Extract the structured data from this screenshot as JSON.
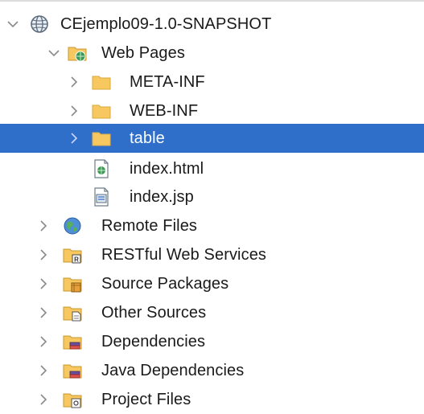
{
  "project_tree": {
    "root": {
      "label": "CEjemplo09-1.0-SNAPSHOT",
      "icon": "globe-project-icon",
      "expanded": true
    },
    "web_pages": {
      "label": "Web Pages",
      "icon": "web-pages-folder-icon",
      "expanded": true
    },
    "meta_inf": {
      "label": "META-INF",
      "icon": "folder-icon"
    },
    "web_inf": {
      "label": "WEB-INF",
      "icon": "folder-icon"
    },
    "table": {
      "label": "table",
      "icon": "folder-icon",
      "selected": true
    },
    "index_html": {
      "label": "index.html",
      "icon": "html-file-icon"
    },
    "index_jsp": {
      "label": "index.jsp",
      "icon": "jsp-file-icon"
    },
    "remote_files": {
      "label": "Remote Files",
      "icon": "remote-globe-icon"
    },
    "restful": {
      "label": "RESTful Web Services",
      "icon": "rest-folder-icon"
    },
    "source_packages": {
      "label": "Source Packages",
      "icon": "source-packages-icon"
    },
    "other_sources": {
      "label": "Other Sources",
      "icon": "other-sources-icon"
    },
    "dependencies": {
      "label": "Dependencies",
      "icon": "dependencies-icon"
    },
    "java_dependencies": {
      "label": "Java Dependencies",
      "icon": "java-dependencies-icon"
    },
    "project_files": {
      "label": "Project Files",
      "icon": "project-files-icon"
    }
  },
  "colors": {
    "selection": "#2f6ec9",
    "folder": "#f6c85f",
    "chevron": "#8a8a8a"
  }
}
